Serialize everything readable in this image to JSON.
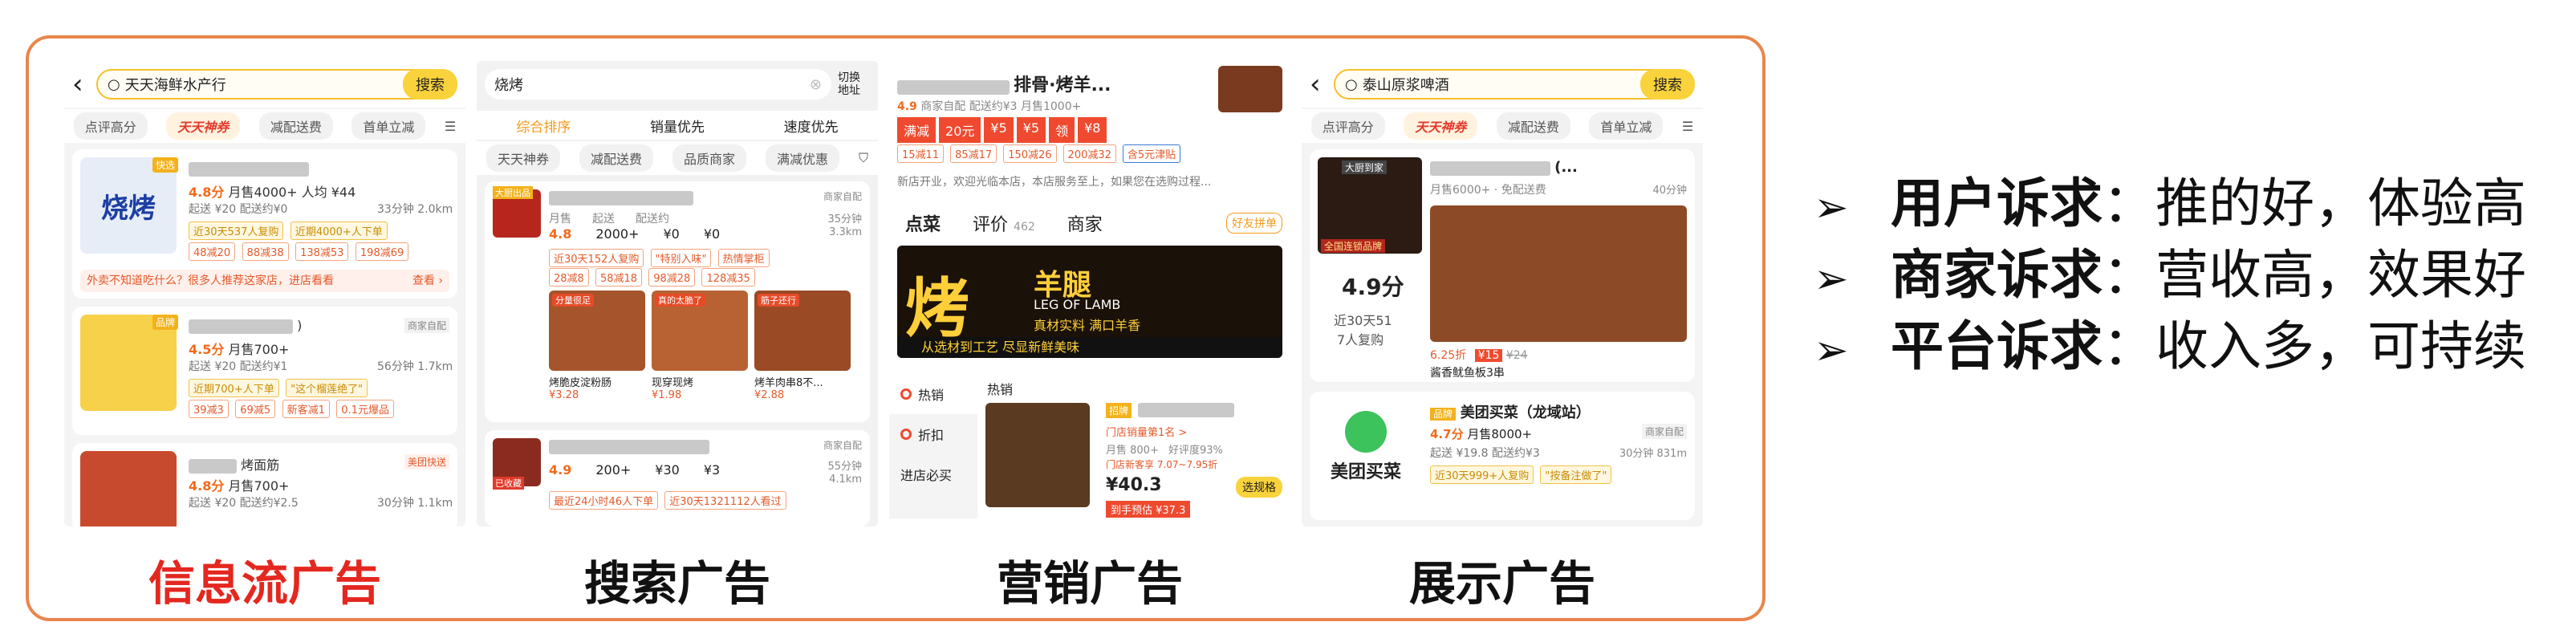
{
  "panels": {
    "p1": {
      "search_text": "天天海鲜水产行",
      "search_btn": "搜索",
      "tabs": [
        "点评高分",
        "天天神券",
        "减配送费",
        "首单立减"
      ],
      "cards": [
        {
          "badge": "快选",
          "rating": "4.8分",
          "sales": "月售4000+ 人均 ¥44",
          "info": "起送 ¥20  配送约¥0",
          "time": "33分钟 2.0km",
          "tags": [
            "近30天537人复购",
            "近期4000+人下单"
          ],
          "coupons": [
            "48减20",
            "88减38",
            "138减53",
            "198减69"
          ],
          "note": "外卖不知道吃什么？很多人推荐这家店，进店看看",
          "more": "查看 ›",
          "img_text": "烧烤"
        },
        {
          "badge": "品牌",
          "title_suffix": ")",
          "rating": "4.5分",
          "sales": "月售700+",
          "info": "起送 ¥20  配送约¥1",
          "time": "56分钟 1.7km",
          "tags": [
            "近期700+人下单",
            "\"这个榴莲绝了\""
          ],
          "coupons": [
            "39减3",
            "69减5",
            "新客减1",
            "0.1元爆品"
          ],
          "shop_tag": "商家自配"
        },
        {
          "title_suffix": "烤面筋",
          "rating": "4.8分",
          "sales": "月售700+",
          "info": "起送 ¥20  配送约¥2.5",
          "time": "30分钟 1.1km",
          "shop_tag": "美团快送"
        }
      ]
    },
    "p2": {
      "search_text": "烧烤",
      "switch_addr": "切换地址",
      "sort": [
        "综合排序",
        "销量优先",
        "速度优先"
      ],
      "filters": [
        "天天神券",
        "减配送费",
        "品质商家",
        "满减优惠"
      ],
      "card1": {
        "badge": "大厨出品",
        "rating": "4.8",
        "sales": "2000+",
        "start": "¥0",
        "delivery": "¥0",
        "time": "35分钟",
        "dist": "3.3km",
        "shop_tag": "商家自配",
        "labels": [
          "月售",
          "起送",
          "配送约"
        ],
        "tags": [
          "近30天152人复购",
          "\"特别入味\"",
          "热情掌柜"
        ],
        "coupons": [
          "28减8",
          "58减18",
          "98减28",
          "128减35"
        ],
        "items": [
          {
            "name": "烤脆皮淀粉肠",
            "price": "¥3.28"
          },
          {
            "name": "现穿现烤",
            "price": "¥1.98"
          },
          {
            "name": "烤羊肉串8不...",
            "price": "¥2.88"
          }
        ],
        "promo_pills": [
          "分量很足",
          "真的太脆了",
          "筋子还行"
        ]
      },
      "card2": {
        "rating": "4.9",
        "sales": "200+",
        "start": "¥30",
        "delivery": "¥3",
        "time": "55分钟",
        "dist": "4.1km",
        "shop_tag": "商家自配",
        "badge": "已收藏",
        "tags": [
          "最近24小时46人下单",
          "近30天1321112人看过"
        ]
      }
    },
    "p3": {
      "title": "排骨·烤羊...",
      "rating": "4.9",
      "meta": "商家自配  配送约¥3  月售1000+",
      "promos": [
        "满减",
        "20元",
        "¥5",
        "¥5",
        "领",
        "¥8"
      ],
      "promos2": [
        "15减11",
        "85减17",
        "150减26",
        "200减32",
        "含5元津贴"
      ],
      "notice": "新店开业，欢迎光临本店，本店服务至上，如果您在选购过程...",
      "tabs": [
        "点菜",
        "评价",
        "商家"
      ],
      "review_count": "462",
      "friend": "好友拼单",
      "banner_big": "烤",
      "banner_title": "羊腿",
      "banner_en": "LEG OF LAMB",
      "banner_sub": "真材实料  满口羊香",
      "banner_foot": "从选材到工艺  尽显新鲜美味",
      "menu": [
        "热销",
        "折扣",
        "进店必买"
      ],
      "section": "热销",
      "dish": {
        "badge": "招牌",
        "rank": "门店销量第1名 >",
        "sales": "月售 800+",
        "praise": "好评度93%",
        "price": "¥40.3",
        "orig": "门店新客享 7.07~7.95折",
        "tag": "选规格",
        "coupon": "到手预估 ¥37.3"
      }
    },
    "p4": {
      "search_text": "泰山原浆啤酒",
      "search_btn": "搜索",
      "tabs": [
        "点评高分",
        "天天神券",
        "减配送费",
        "首单立减"
      ],
      "card1": {
        "title_suffix": "(...",
        "sales": "月售6000+ · 免配送费",
        "time": "40分钟",
        "score": "4.9分",
        "rebuy": "近30天51",
        "rebuy2": "7人复购",
        "badge": "大厨到家",
        "discount": "6.25折",
        "price": "¥15",
        "orig": "¥24",
        "dish": "酱香鱿鱼板3串",
        "pill": "全国连锁品牌"
      },
      "card2": {
        "name": "美团买菜（龙域站）",
        "badge": "品牌",
        "rating": "4.7分",
        "sales": "月售8000+",
        "info": "起送 ¥19.8  配送约¥3",
        "time": "30分钟 831m",
        "shop_tag": "商家自配",
        "logo_text": "美团买菜",
        "tags": [
          "近30天999+人复购",
          "\"按备注做了\""
        ]
      }
    }
  },
  "captions": [
    "信息流广告",
    "搜索广告",
    "营销广告",
    "展示广告"
  ],
  "bullets": [
    {
      "head": "用户诉求",
      "body": "：推的好，体验高"
    },
    {
      "head": "商家诉求",
      "body": "：营收高，效果好"
    },
    {
      "head": "平台诉求",
      "body": "：收入多，可持续"
    }
  ],
  "colors": {
    "frame": "#e8864d",
    "caption_red": "#e4271f",
    "accent_yellow": "#f9d23c",
    "promo_red": "#ef4a2f"
  }
}
